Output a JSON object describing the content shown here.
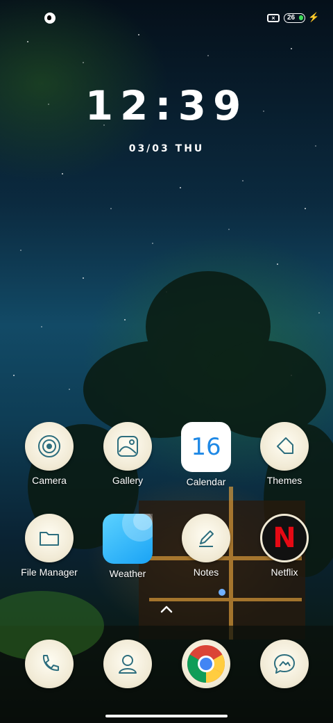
{
  "status_bar": {
    "battery_level": "26",
    "bolt": "⚡"
  },
  "lockscreen": {
    "time": "12:39",
    "date": "03/03 THU"
  },
  "apps_row1": [
    {
      "label": "Camera"
    },
    {
      "label": "Gallery"
    },
    {
      "label": "Calendar",
      "day": "16"
    },
    {
      "label": "Themes"
    }
  ],
  "apps_row2": [
    {
      "label": "File Manager"
    },
    {
      "label": "Weather"
    },
    {
      "label": "Notes"
    },
    {
      "label": "Netflix",
      "glyph": "N"
    }
  ],
  "colors": {
    "icon_bg": "#f1ead5",
    "icon_stroke": "#2d6e7e",
    "netflix_red": "#e50914",
    "calendar_blue": "#1e88e5"
  }
}
